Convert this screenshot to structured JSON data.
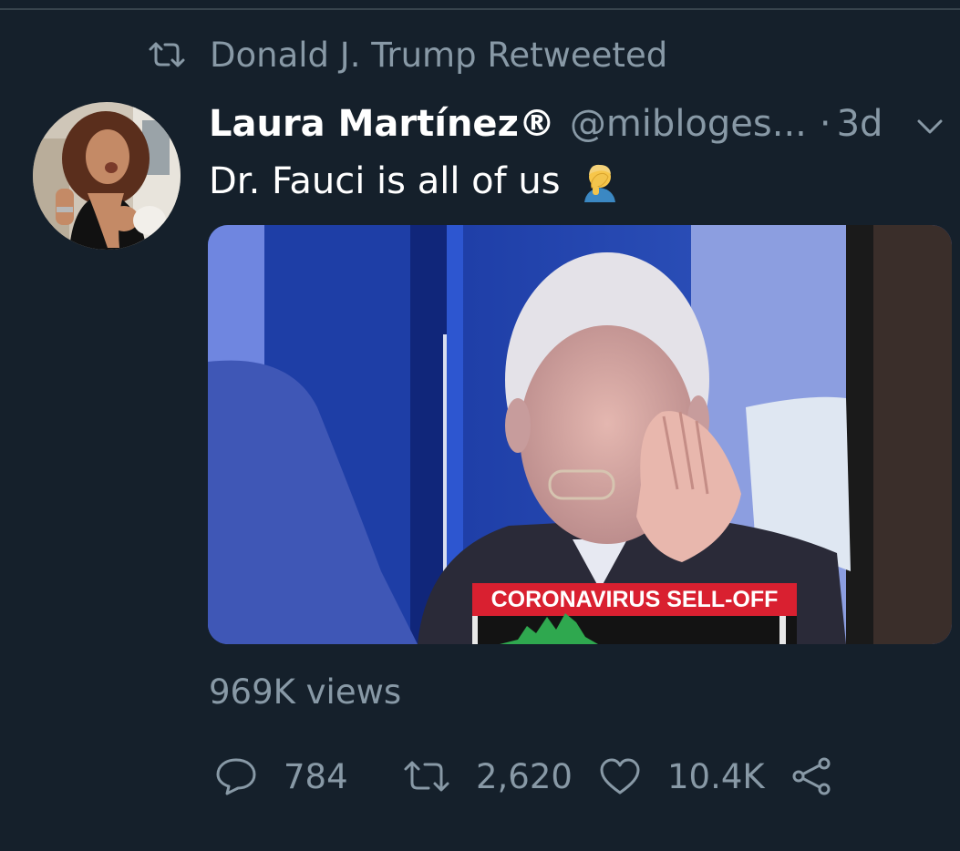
{
  "retweet_context": {
    "text": "Donald J. Trump Retweeted",
    "icon": "retweet-icon"
  },
  "tweet": {
    "author_name": "Laura Martínez®",
    "author_handle": "@mibloges...",
    "separator": "·",
    "timestamp": "3d",
    "text": "Dr. Fauci is all of us",
    "emoji": "man-facepalming-emoji",
    "media": {
      "chyron": "CORONAVIRUS SELL-OFF"
    },
    "views": "969K views",
    "actions": {
      "reply_count": "784",
      "retweet_count": "2,620",
      "like_count": "10.4K"
    }
  },
  "colors": {
    "background": "#15202b",
    "secondary_text": "#8899a6",
    "primary_text": "#ffffff",
    "chyron_red": "#d92030"
  }
}
